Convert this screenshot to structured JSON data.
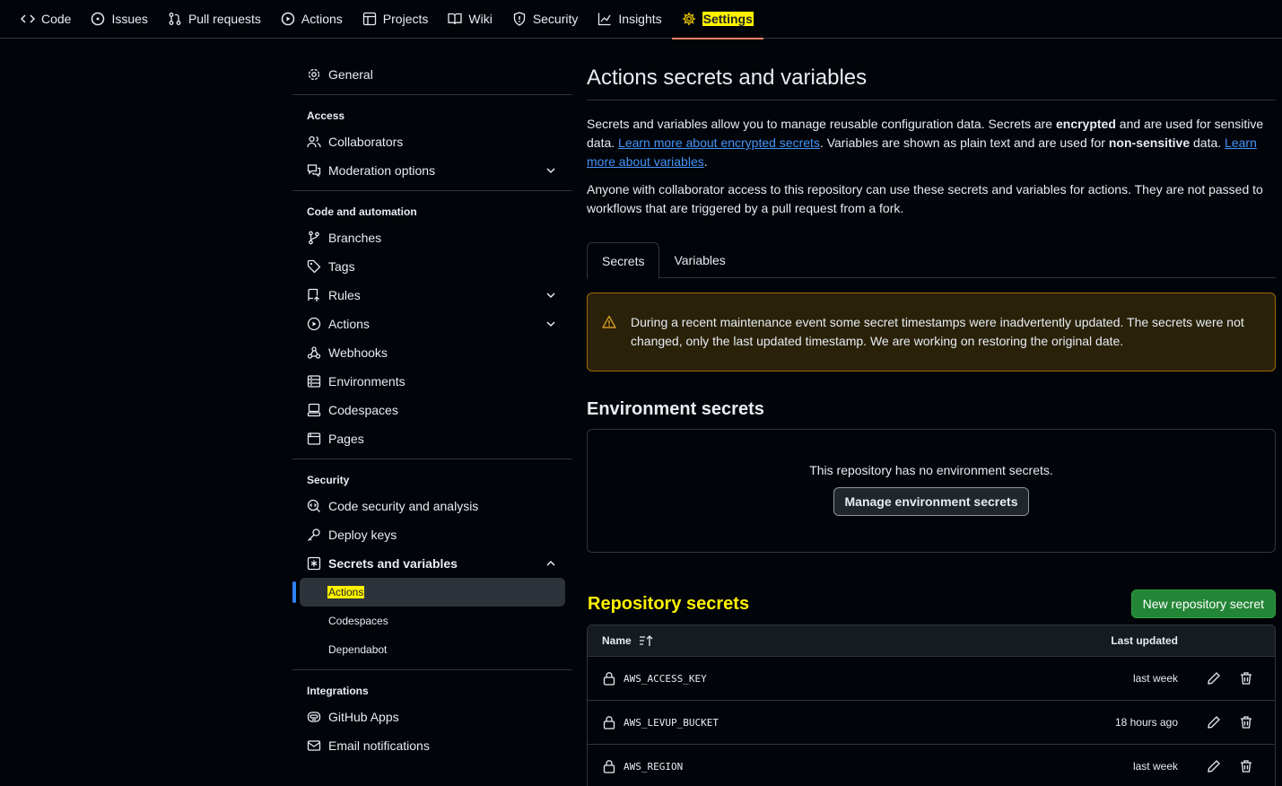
{
  "nav": {
    "tabs": [
      {
        "label": "Code",
        "icon": "code-icon"
      },
      {
        "label": "Issues",
        "icon": "issue-icon"
      },
      {
        "label": "Pull requests",
        "icon": "pull-request-icon"
      },
      {
        "label": "Actions",
        "icon": "play-icon"
      },
      {
        "label": "Projects",
        "icon": "table-icon"
      },
      {
        "label": "Wiki",
        "icon": "book-icon"
      },
      {
        "label": "Security",
        "icon": "shield-icon"
      },
      {
        "label": "Insights",
        "icon": "graph-icon"
      },
      {
        "label": "Settings",
        "icon": "gear-icon"
      }
    ],
    "active": "Settings"
  },
  "sidebar": {
    "general": "General",
    "access_heading": "Access",
    "access": [
      "Collaborators",
      "Moderation options"
    ],
    "code_heading": "Code and automation",
    "code": [
      "Branches",
      "Tags",
      "Rules",
      "Actions",
      "Webhooks",
      "Environments",
      "Codespaces",
      "Pages"
    ],
    "security_heading": "Security",
    "security": [
      "Code security and analysis",
      "Deploy keys",
      "Secrets and variables"
    ],
    "secrets_sub": [
      "Actions",
      "Codespaces",
      "Dependabot"
    ],
    "integrations_heading": "Integrations",
    "integrations": [
      "GitHub Apps",
      "Email notifications"
    ]
  },
  "main": {
    "title": "Actions secrets and variables",
    "intro": {
      "p1_a": "Secrets and variables allow you to manage reusable configuration data. Secrets are ",
      "p1_b": "encrypted",
      "p1_c": " and are used for sensitive data. ",
      "link1": "Learn more about encrypted secrets",
      "p1_d": ". Variables are shown as plain text and are used for ",
      "p1_e": "non-sensitive",
      "p1_f": " data. ",
      "link2": "Learn more about variables",
      "p1_g": "."
    },
    "p2": "Anyone with collaborator access to this repository can use these secrets and variables for actions. They are not passed to workflows that are triggered by a pull request from a fork.",
    "tabs": [
      "Secrets",
      "Variables"
    ],
    "warning": "During a recent maintenance event some secret timestamps were inadvertently updated. The secrets were not changed, only the last updated timestamp. We are working on restoring the original date.",
    "env_heading": "Environment secrets",
    "env_empty": "This repository has no environment secrets.",
    "env_button": "Manage environment secrets",
    "repo_heading": "Repository secrets",
    "new_button": "New repository secret",
    "table": {
      "col_name": "Name",
      "col_updated": "Last updated",
      "rows": [
        {
          "name": "AWS_ACCESS_KEY",
          "updated": "last week"
        },
        {
          "name": "AWS_LEVUP_BUCKET",
          "updated": "18 hours ago"
        },
        {
          "name": "AWS_REGION",
          "updated": "last week"
        }
      ]
    }
  },
  "colors": {
    "highlight": "#fff200",
    "accent_blue": "#2f81f7",
    "link": "#4493f8",
    "green_button": "#238636",
    "warning_border": "#9e6a03"
  }
}
